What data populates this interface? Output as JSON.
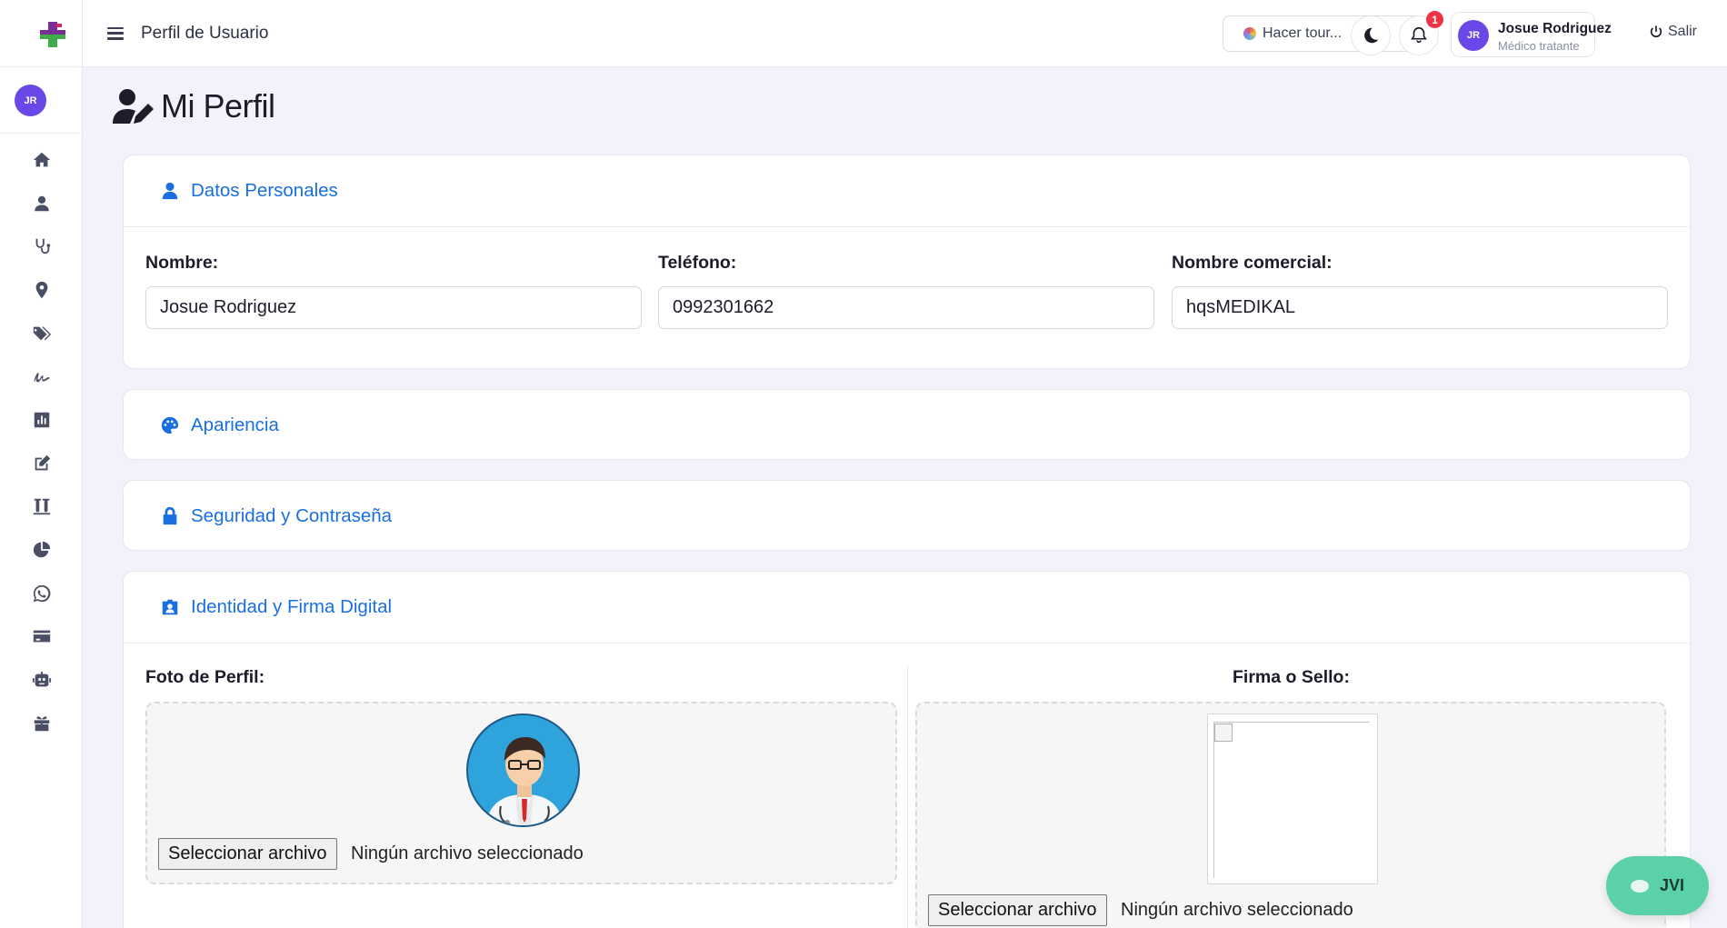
{
  "header": {
    "title": "Perfil de Usuario",
    "tour_label": "Hacer tour...",
    "notifications_count": "1",
    "user_name": "Josue Rodriguez",
    "user_role": "Médico tratante",
    "user_initials": "JR",
    "logout_label": "Salir"
  },
  "sidebar": {
    "avatar_initials": "JR",
    "items": [
      {
        "icon": "home-icon"
      },
      {
        "icon": "user-icon"
      },
      {
        "icon": "stethoscope-icon"
      },
      {
        "icon": "location-pin-icon"
      },
      {
        "icon": "tags-icon"
      },
      {
        "icon": "signature-icon"
      },
      {
        "icon": "bar-chart-icon"
      },
      {
        "icon": "edit-icon"
      },
      {
        "icon": "vials-icon"
      },
      {
        "icon": "pie-chart-icon"
      },
      {
        "icon": "whatsapp-icon"
      },
      {
        "icon": "credit-card-icon"
      },
      {
        "icon": "robot-icon"
      },
      {
        "icon": "gift-icon"
      }
    ]
  },
  "page": {
    "title": "Mi Perfil"
  },
  "personal": {
    "title": "Datos Personales",
    "name_label": "Nombre:",
    "name_value": "Josue Rodriguez",
    "phone_label": "Teléfono:",
    "phone_value": "0992301662",
    "company_label": "Nombre comercial:",
    "company_value": "hqsMEDIKAL"
  },
  "appearance": {
    "title": "Apariencia"
  },
  "security": {
    "title": "Seguridad y Contraseña"
  },
  "identity": {
    "title": "Identidad y Firma Digital",
    "photo_label": "Foto de Perfil:",
    "signature_label": "Firma o Sello:",
    "file_button": "Seleccionar archivo",
    "no_file": "Ningún archivo seleccionado"
  },
  "chat": {
    "label": "JVI"
  },
  "colors": {
    "accent": "#1a6fe0",
    "avatar": "#6a48e8",
    "chat": "#5ad1a6",
    "badge": "#ee3344"
  }
}
